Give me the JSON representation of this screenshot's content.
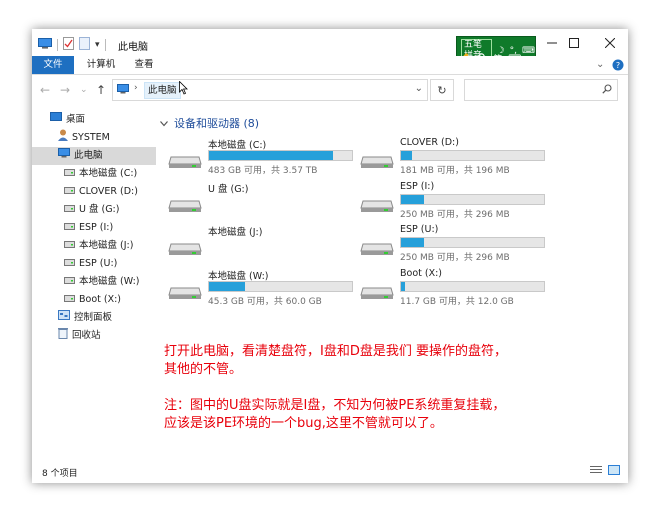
{
  "window": {
    "title": "此电脑"
  },
  "ime": {
    "row1": [
      "五笔拼音",
      "☽",
      "°,",
      "⌨"
    ],
    "row2": [
      "✋",
      "🔍",
      "简",
      "⌨"
    ]
  },
  "ribbon": {
    "tabs": [
      "文件",
      "计算机",
      "查看"
    ]
  },
  "address": {
    "path": "此电脑"
  },
  "sidebar": {
    "items": [
      {
        "label": "桌面",
        "icon": "desktop-icon"
      },
      {
        "label": "SYSTEM",
        "icon": "user-icon"
      },
      {
        "label": "此电脑",
        "icon": "computer-icon"
      },
      {
        "label": "本地磁盘 (C:)",
        "icon": "drive-icon"
      },
      {
        "label": "CLOVER (D:)",
        "icon": "drive-icon"
      },
      {
        "label": "U 盘 (G:)",
        "icon": "drive-icon"
      },
      {
        "label": "ESP (I:)",
        "icon": "drive-icon"
      },
      {
        "label": "本地磁盘 (J:)",
        "icon": "drive-icon"
      },
      {
        "label": "ESP (U:)",
        "icon": "drive-icon"
      },
      {
        "label": "本地磁盘 (W:)",
        "icon": "drive-icon"
      },
      {
        "label": "Boot (X:)",
        "icon": "drive-icon"
      },
      {
        "label": "控制面板",
        "icon": "control-panel-icon"
      },
      {
        "label": "回收站",
        "icon": "recycle-bin-icon"
      }
    ]
  },
  "content": {
    "group_title": "设备和驱动器 (8)",
    "drives": [
      {
        "name": "本地磁盘 (C:)",
        "info": "483 GB 可用，共 3.57 TB",
        "used": 0.87,
        "has_bar": true
      },
      {
        "name": "CLOVER (D:)",
        "info": "181 MB 可用，共 196 MB",
        "used": 0.08,
        "has_bar": true
      },
      {
        "name": "U 盘 (G:)",
        "info": "",
        "used": 0,
        "has_bar": false
      },
      {
        "name": "ESP (I:)",
        "info": "250 MB 可用，共 296 MB",
        "used": 0.16,
        "has_bar": true
      },
      {
        "name": "本地磁盘 (J:)",
        "info": "",
        "used": 0,
        "has_bar": false
      },
      {
        "name": "ESP (U:)",
        "info": "250 MB 可用，共 296 MB",
        "used": 0.16,
        "has_bar": true
      },
      {
        "name": "本地磁盘 (W:)",
        "info": "45.3 GB 可用，共 60.0 GB",
        "used": 0.25,
        "has_bar": true
      },
      {
        "name": "Boot (X:)",
        "info": "11.7 GB 可用，共 12.0 GB",
        "used": 0.03,
        "has_bar": true
      }
    ],
    "note_lines": [
      "打开此电脑，看清楚盘符，I盘和D盘是我们 要操作的盘符，",
      "其他的不管。",
      "注：图中的U盘实际就是I盘，不知为何被PE系统重复挂载，",
      "应该是该PE环境的一个bug,这里不管就可以了。"
    ]
  },
  "status": {
    "item_count": "8 个项目"
  },
  "colors": {
    "accent": "#1e6fc1",
    "bar_fill": "#26a0da",
    "note_red": "#e8000b",
    "ime_green": "#0f7a2a"
  }
}
